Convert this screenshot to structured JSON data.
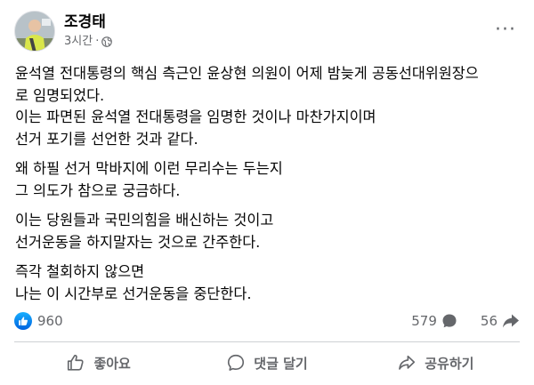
{
  "post": {
    "author": "조경태",
    "time": "3시간",
    "separator": "·",
    "privacy_icon": "globe-icon",
    "more_icon": "more-icon",
    "more_label": "···",
    "paragraphs": [
      [
        "윤석열 전대통령의 핵심 측근인 윤상현 의원이 어제 밤늦게 공동선대위원장으",
        "로 임명되었다.",
        "이는 파면된 윤석열 전대통령을 임명한 것이나 마찬가지이며",
        "선거 포기를 선언한 것과 같다."
      ],
      [
        "왜 하필 선거 막바지에 이런 무리수는 두는지",
        "그 의도가 참으로 궁금하다."
      ],
      [
        "이는 당원들과 국민의힘을 배신하는 것이고",
        "선거운동을 하지말자는 것으로 간주한다."
      ],
      [
        "즉각 철회하지 않으면",
        "나는 이 시간부로 선거운동을 중단한다."
      ]
    ]
  },
  "stats": {
    "likes": "960",
    "comments": "579",
    "shares": "56"
  },
  "actions": {
    "like": "좋아요",
    "comment": "댓글 달기",
    "share": "공유하기"
  },
  "colors": {
    "text": "#050505",
    "secondary": "#65676b",
    "like_blue": "#0866ff",
    "divider": "#ced0d4"
  }
}
